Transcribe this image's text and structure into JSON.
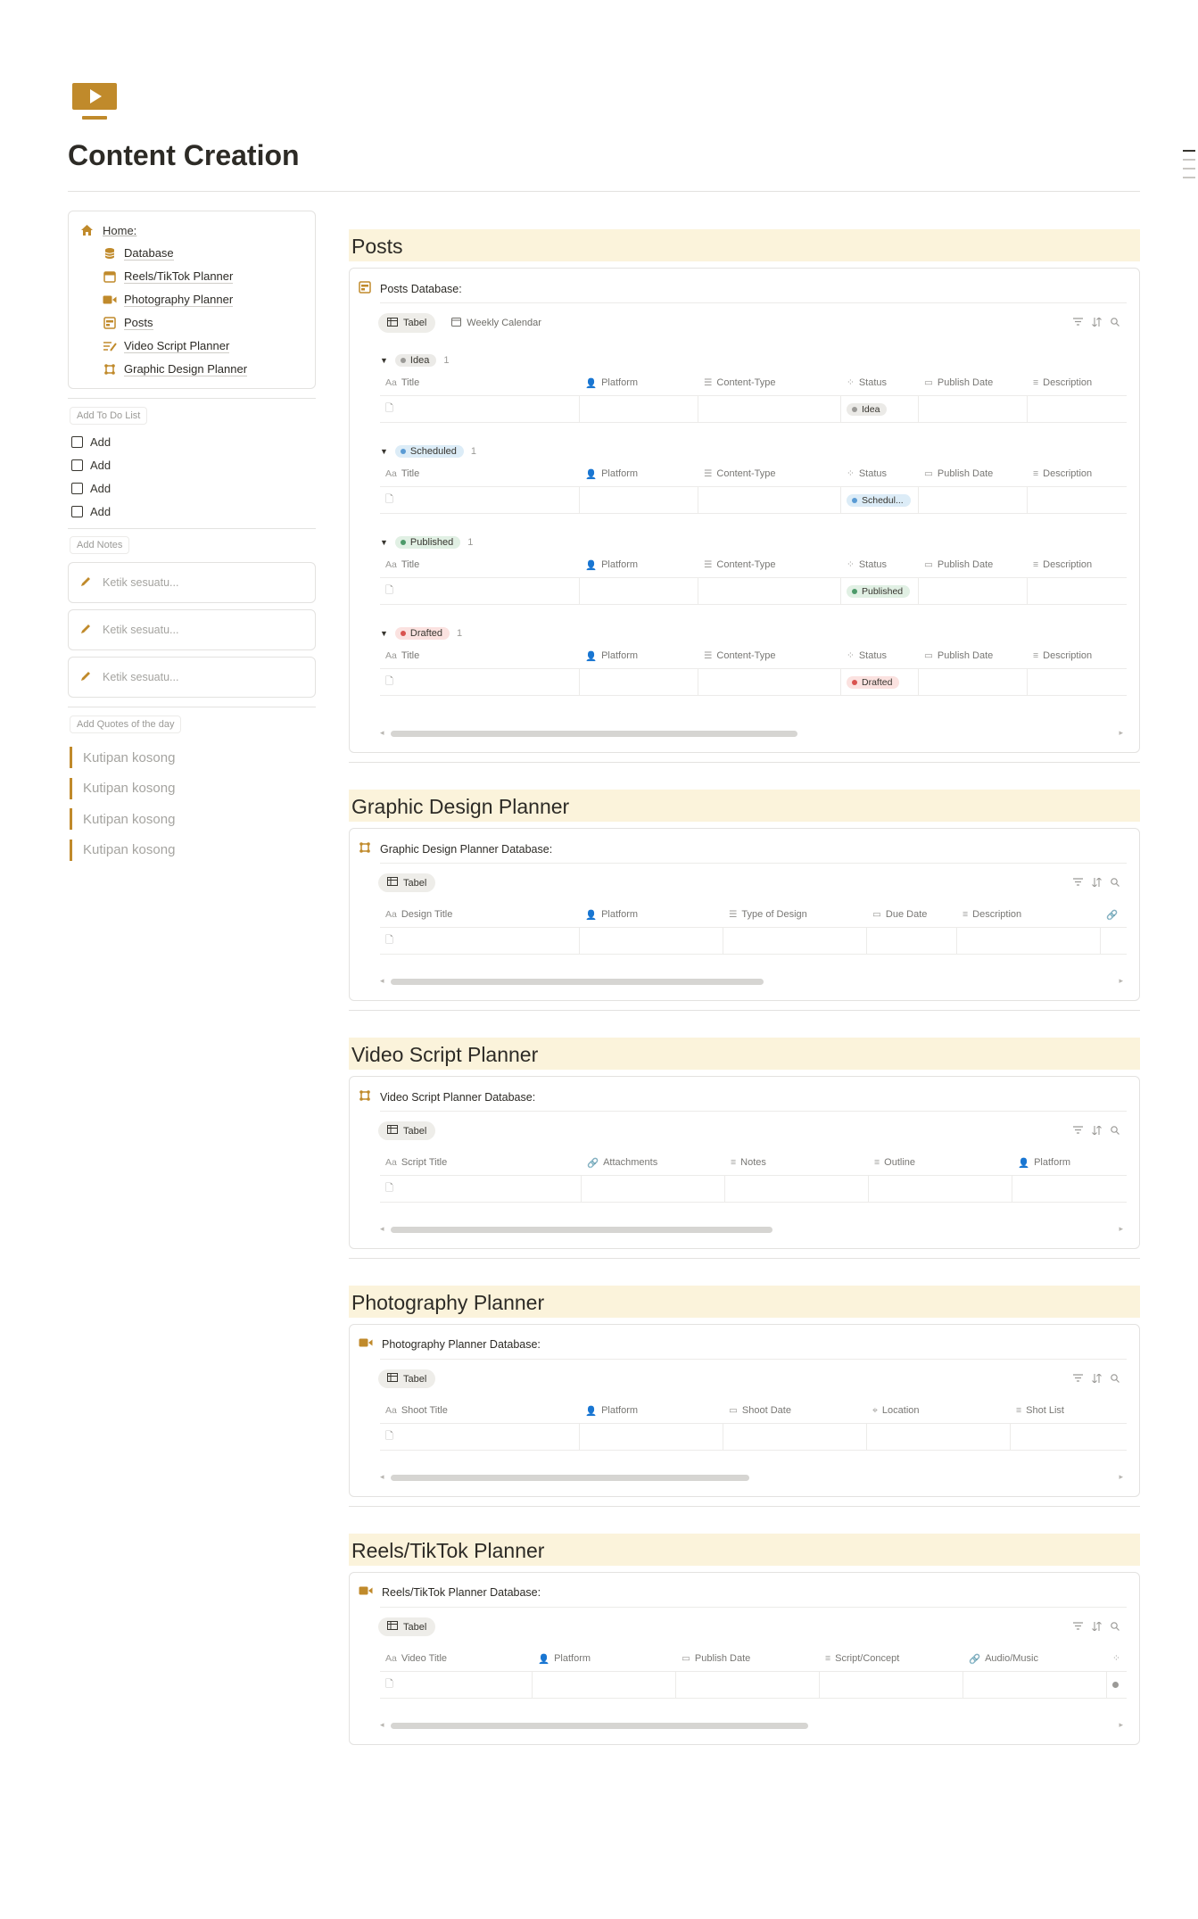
{
  "page": {
    "title": "Content Creation",
    "icon": "video-play-icon",
    "accent": "#c08a2b"
  },
  "nav": {
    "home_label": "Home:",
    "items": [
      {
        "label": "Database",
        "icon": "database-icon"
      },
      {
        "label": "Reels/TikTok Planner",
        "icon": "calendar-icon"
      },
      {
        "label": "Photography Planner",
        "icon": "video-camera-icon"
      },
      {
        "label": "Posts",
        "icon": "board-icon"
      },
      {
        "label": "Video Script Planner",
        "icon": "list-edit-icon"
      },
      {
        "label": "Graphic Design Planner",
        "icon": "frame-icon"
      }
    ]
  },
  "todo": {
    "label": "Add To Do List",
    "items": [
      "Add",
      "Add",
      "Add",
      "Add"
    ]
  },
  "notes": {
    "label": "Add Notes",
    "placeholder": "Ketik sesuatu...",
    "items": [
      "Ketik sesuatu...",
      "Ketik sesuatu...",
      "Ketik sesuatu..."
    ]
  },
  "quotes": {
    "label": "Add Quotes of the day",
    "items": [
      "Kutipan kosong",
      "Kutipan kosong",
      "Kutipan kosong",
      "Kutipan kosong"
    ]
  },
  "posts": {
    "heading": "Posts",
    "db_title": "Posts Database:",
    "views": [
      "Tabel",
      "Weekly Calendar"
    ],
    "columns": [
      "Title",
      "Platform",
      "Content-Type",
      "Status",
      "Publish Date",
      "Description"
    ],
    "groups": [
      {
        "name": "Idea",
        "count": "1",
        "status": "Idea",
        "color": "#9b9a97",
        "bg": "#ebeae7"
      },
      {
        "name": "Scheduled",
        "count": "1",
        "status": "Schedul...",
        "color": "#5a9bd4",
        "bg": "#dcecf7"
      },
      {
        "name": "Published",
        "count": "1",
        "status": "Published",
        "color": "#4d9a6a",
        "bg": "#e1f0e4"
      },
      {
        "name": "Drafted",
        "count": "1",
        "status": "Drafted",
        "color": "#d9534f",
        "bg": "#fbe2e0"
      }
    ]
  },
  "graphic": {
    "heading": "Graphic Design Planner",
    "db_title": "Graphic Design Planner Database:",
    "views": [
      "Tabel"
    ],
    "columns": [
      "Design Title",
      "Platform",
      "Type of Design",
      "Due Date",
      "Description",
      ""
    ]
  },
  "video": {
    "heading": "Video Script Planner",
    "db_title": "Video Script Planner Database:",
    "views": [
      "Tabel"
    ],
    "columns": [
      "Script Title",
      "Attachments",
      "Notes",
      "Outline",
      "Platform"
    ]
  },
  "photo": {
    "heading": "Photography Planner",
    "db_title": "Photography Planner Database:",
    "views": [
      "Tabel"
    ],
    "columns": [
      "Shoot Title",
      "Platform",
      "Shoot Date",
      "Location",
      "Shot List"
    ]
  },
  "reels": {
    "heading": "Reels/TikTok Planner",
    "db_title": "Reels/TikTok Planner Database:",
    "views": [
      "Tabel"
    ],
    "columns": [
      "Video Title",
      "Platform",
      "Publish Date",
      "Script/Concept",
      "Audio/Music",
      ""
    ]
  }
}
